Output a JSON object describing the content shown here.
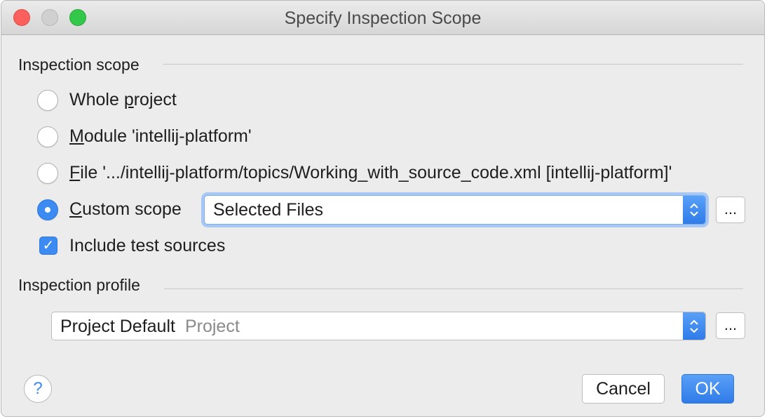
{
  "window": {
    "title": "Specify Inspection Scope"
  },
  "scope": {
    "section_title": "Inspection scope",
    "whole_project": {
      "mnemonic": "Whole p",
      "rest_before": "Whole ",
      "underline": "p",
      "rest_after": "roject"
    },
    "module": {
      "underline": "M",
      "rest": "odule 'intellij-platform'"
    },
    "file": {
      "underline": "F",
      "rest": "ile '.../intellij-platform/topics/Working_with_source_code.xml [intellij-platform]'"
    },
    "custom": {
      "underline": "C",
      "rest": "ustom scope",
      "selected": true
    },
    "custom_combo_value": "Selected Files",
    "include_tests_label": "Include test sources",
    "include_tests_checked": true,
    "checkmark": "✓",
    "ellipsis": "..."
  },
  "profile": {
    "section_title": "Inspection profile",
    "value": "Project Default",
    "secondary": "Project",
    "ellipsis": "..."
  },
  "footer": {
    "help": "?",
    "cancel": "Cancel",
    "ok": "OK"
  },
  "colors": {
    "accent": "#3b8bf2",
    "focus_ring": "#a7c8f4"
  }
}
